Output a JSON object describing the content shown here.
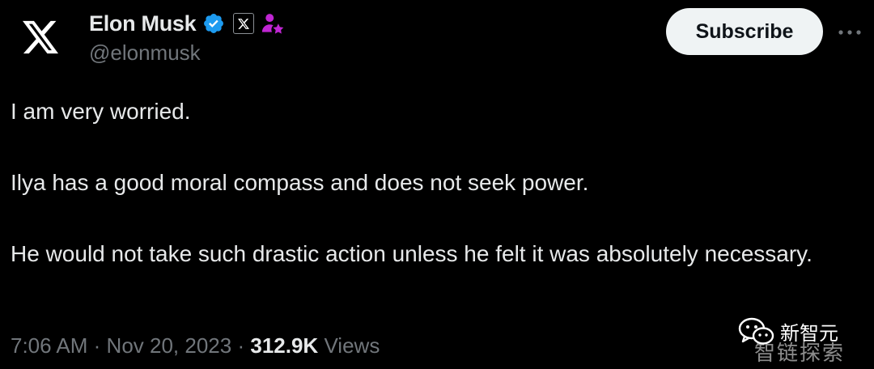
{
  "author": {
    "display_name": "Elon Musk",
    "handle": "@elonmusk",
    "avatar_icon": "x-logo-icon",
    "verified_icon": "verified-badge-icon",
    "affiliate_icon": "x-affiliate-badge-icon",
    "extra_icon": "person-star-icon"
  },
  "actions": {
    "subscribe_label": "Subscribe",
    "more_icon": "more-options-icon"
  },
  "tweet": {
    "paragraphs": [
      "I am very worried.",
      "Ilya has a good moral compass and does not seek power.",
      "He would not take such drastic action unless he felt it was absolutely necessary."
    ]
  },
  "meta": {
    "time": "7:06 AM",
    "separator": "·",
    "date": "Nov 20, 2023",
    "views_count": "312.9K",
    "views_label": "Views"
  },
  "watermark": {
    "line1": "新智元",
    "line2": "智链探索",
    "icon": "wechat-icon"
  },
  "colors": {
    "background": "#000000",
    "text_primary": "#e7e9ea",
    "text_secondary": "#71767b",
    "verified_blue": "#1d9bf0",
    "badge_purple": "#c026d3",
    "button_bg": "#eff3f4"
  }
}
